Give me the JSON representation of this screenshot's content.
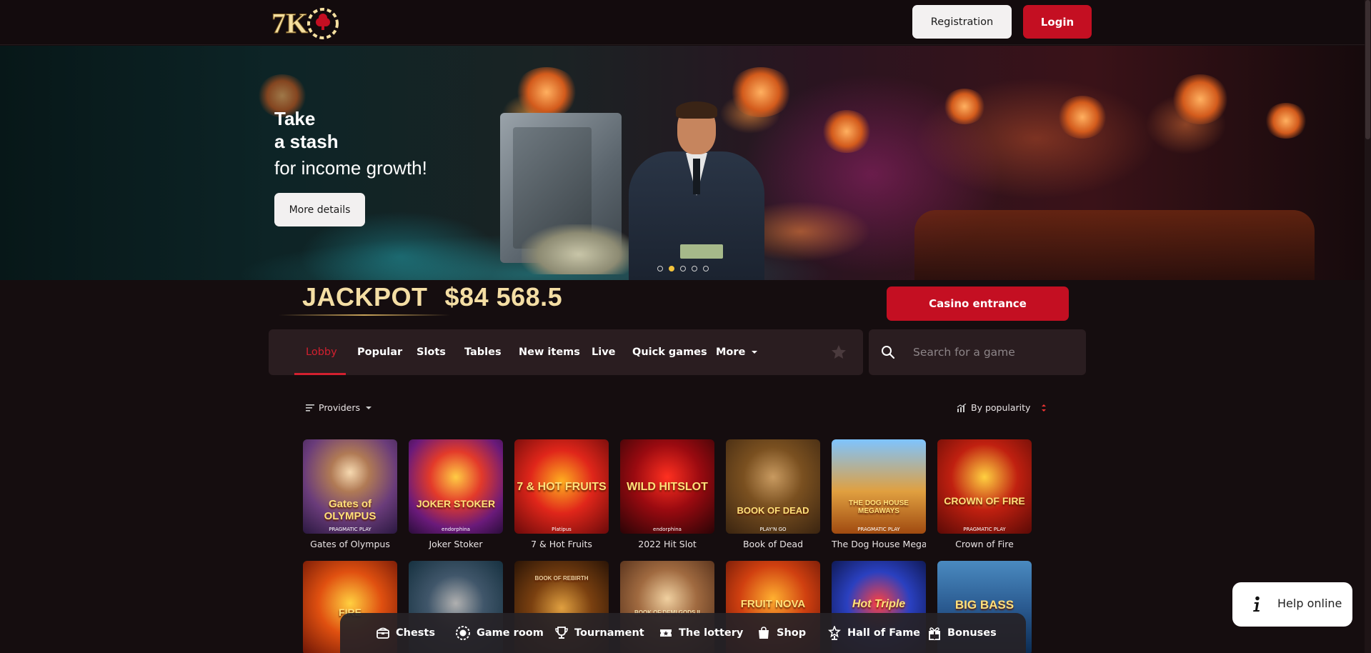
{
  "header": {
    "logo_text": "7K",
    "registration_label": "Registration",
    "login_label": "Login"
  },
  "banner": {
    "title_line1": "Take",
    "title_line2": "a stash",
    "subtitle": "for income growth!",
    "button_label": "More details",
    "slide_count": 5,
    "active_slide": 2
  },
  "jackpot": {
    "label": "JACKPOT",
    "value": "$84 568.5",
    "casino_button_label": "Casino entrance"
  },
  "tabs": [
    {
      "label": "Lobby",
      "active": true
    },
    {
      "label": "Popular"
    },
    {
      "label": "Slots"
    },
    {
      "label": "Tables"
    },
    {
      "label": "New items"
    },
    {
      "label": "Live"
    },
    {
      "label": "Quick games"
    },
    {
      "label": "More"
    }
  ],
  "search": {
    "placeholder": "Search for a game"
  },
  "filters": {
    "providers_label": "Providers",
    "sort_label": "By popularity"
  },
  "games_row1": [
    {
      "name": "Gates of Olympus",
      "art_text": "Gates of OLYMPUS",
      "provider": "PRAGMATIC PLAY"
    },
    {
      "name": "Joker Stoker",
      "art_text": "JOKER STOKER",
      "provider": "endorphina"
    },
    {
      "name": "7 & Hot Fruits",
      "art_text": "7 & HOT FRUITS",
      "provider": "Platipus"
    },
    {
      "name": "2022 Hit Slot",
      "art_text": "WILD HITSLOT",
      "provider": "endorphina"
    },
    {
      "name": "Book of Dead",
      "art_text": "BOOK OF DEAD",
      "provider": "PLAY'N GO"
    },
    {
      "name": "The Dog House Mega...",
      "art_text": "THE DOG HOUSE MEGAWAYS",
      "provider": "PRAGMATIC PLAY"
    },
    {
      "name": "Crown of Fire",
      "art_text": "CROWN OF FIRE",
      "provider": "PRAGMATIC PLAY"
    }
  ],
  "games_row2": [
    {
      "art_text": "FIRE"
    },
    {
      "art_text": ""
    },
    {
      "art_text": "BOOK OF REBIRTH"
    },
    {
      "art_text": "BOOK OF DEMI GODS II"
    },
    {
      "art_text": "FRUIT NOVA"
    },
    {
      "art_text": "Hot Triple"
    },
    {
      "art_text": "BIG BASS"
    }
  ],
  "bottom_nav": [
    {
      "label": "Chests",
      "icon": "chest-icon"
    },
    {
      "label": "Game room",
      "icon": "chip-icon"
    },
    {
      "label": "Tournament",
      "icon": "trophy-icon"
    },
    {
      "label": "The lottery",
      "icon": "ticket-icon"
    },
    {
      "label": "Shop",
      "icon": "bag-icon"
    },
    {
      "label": "Hall of Fame",
      "icon": "award-icon"
    },
    {
      "label": "Bonuses",
      "icon": "gift-icon"
    }
  ],
  "help": {
    "label": "Help online"
  },
  "colors": {
    "background": "#150d0f",
    "accent_red": "#c40f22",
    "jackpot_gold": "#f4dea4",
    "panel": "#2a1d20"
  }
}
